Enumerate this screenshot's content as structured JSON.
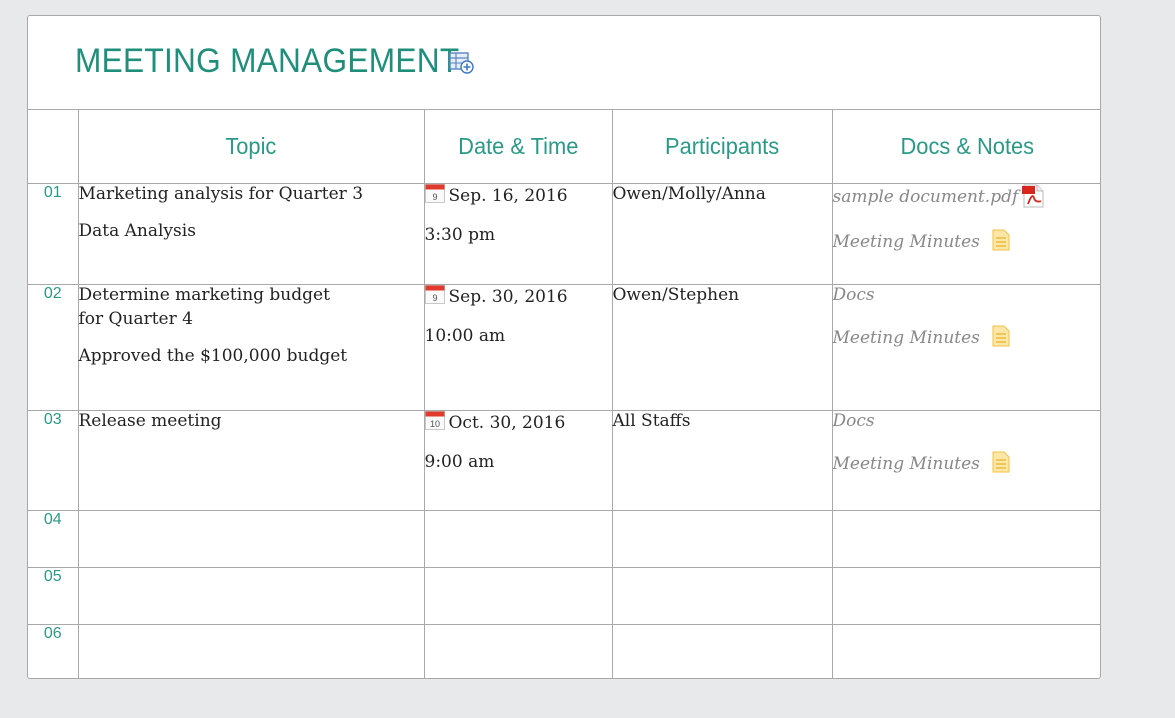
{
  "title": "MEETING MANAGEMENT",
  "colors": {
    "accent": "#1f8f7b",
    "border": "#a9a9a9",
    "background": "#e8e9eb"
  },
  "headers": [
    "Topic",
    "Date & Time",
    "Participants",
    "Docs & Notes"
  ],
  "rows": [
    {
      "num": "01",
      "topic": "Marketing analysis for Quarter 3",
      "notes": "Data Analysis",
      "date": "Sep. 16, 2016",
      "cal_day": "9",
      "time": "3:30 pm",
      "participants": "Owen/Molly/Anna",
      "doc": "sample document.pdf",
      "minutes": "Meeting Minutes"
    },
    {
      "num": "02",
      "topic_line1": "Determine  marketing budget",
      "topic_line2": "for Quarter 4",
      "notes": "Approved the $100,000 budget",
      "date": "Sep. 30, 2016",
      "cal_day": "9",
      "time": "10:00 am",
      "participants": "Owen/Stephen",
      "doc": "Docs",
      "minutes": "Meeting Minutes"
    },
    {
      "num": "03",
      "topic": "Release meeting",
      "date": "Oct. 30, 2016",
      "cal_day": "10",
      "time": "9:00 am",
      "participants": "All Staffs",
      "doc": "Docs",
      "minutes": "Meeting Minutes"
    },
    {
      "num": "04"
    },
    {
      "num": "05"
    },
    {
      "num": "06"
    }
  ]
}
